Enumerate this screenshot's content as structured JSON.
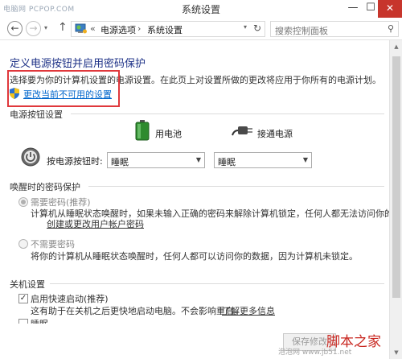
{
  "window": {
    "title": "系统设置",
    "watermark": "电脑网 PCPOP.COM",
    "minimize_glyph": "—",
    "maximize_glyph": "☐",
    "close_glyph": "✕"
  },
  "address": {
    "history_glyph": "▾",
    "separator": "«",
    "crumbs": [
      "电源选项",
      "系统设置"
    ],
    "crumb_separator": "›",
    "dropdown_glyph": "▾",
    "refresh_glyph": "↻"
  },
  "search": {
    "placeholder": "搜索控制面板"
  },
  "main": {
    "title": "定义电源按钮并启用密码保护",
    "description": "选择要为你的计算机设置的电源设置。在此页上对设置所做的更改将应用于你所有的电源计划。",
    "change_link": "更改当前不可用的设置"
  },
  "power_buttons": {
    "heading": "电源按钮设置",
    "battery_label": "用电池",
    "plugged_label": "接通电源",
    "row_label": "按电源按钮时:",
    "battery_value": "睡眠",
    "plugged_value": "睡眠"
  },
  "password": {
    "heading": "唤醒时的密码保护",
    "require_label": "需要密码(推荐)",
    "require_desc": "计算机从睡眠状态唤醒时，如果未输入正确的密码来解除计算机锁定，任何人都无法访问你的数据。",
    "account_link": "创建或更改用户帐户密码",
    "norequire_label": "不需要密码",
    "norequire_desc": "将你的计算机从睡眠状态唤醒时，任何人都可以访问你的数据，因为计算机未锁定。"
  },
  "shutdown": {
    "heading": "关机设置",
    "fast_startup_label": "启用快速启动(推荐)",
    "fast_startup_desc": "这有助于在关机之后更快地启动电脑。不会影响重启。",
    "learn_more_link": "了解更多信息",
    "sleep_label": "睡眠"
  },
  "footer": {
    "save_label": "保存修改",
    "watermark": "脚本之家",
    "watermark_url": "泡泡网 www.jb51.net"
  },
  "colors": {
    "title_blue": "#1e3287",
    "link_blue": "#0066cc",
    "highlight_red": "#e0383c",
    "close_red": "#c7352c"
  }
}
